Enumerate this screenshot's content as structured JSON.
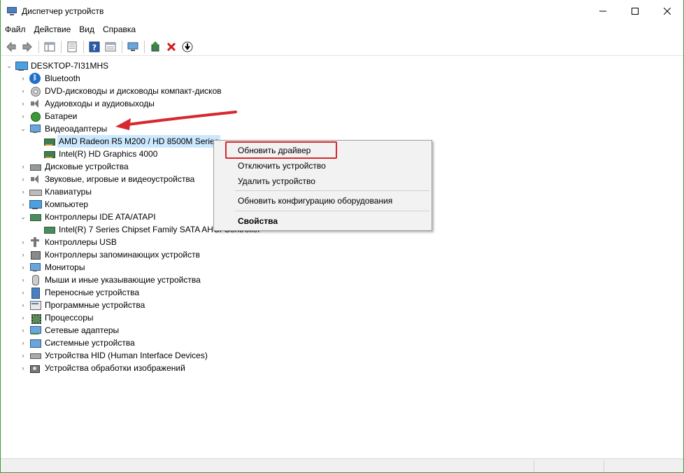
{
  "window": {
    "title": "Диспетчер устройств",
    "controls": {
      "minimize": "—",
      "maximize": "☐",
      "close": "✕"
    }
  },
  "menu": [
    "Файл",
    "Действие",
    "Вид",
    "Справка"
  ],
  "toolbar": {
    "icons": [
      "back-arrow-icon",
      "forward-arrow-icon",
      "properties-pane-icon",
      "list-view-icon",
      "help-icon",
      "details-icon",
      "scan-hardware-icon",
      "update-driver-icon",
      "uninstall-icon",
      "disable-icon"
    ]
  },
  "tree": {
    "root": "DESKTOP-7I31MHS",
    "items": [
      {
        "label": "Bluetooth",
        "icon": "bluetooth-icon",
        "expanded": false
      },
      {
        "label": "DVD-дисководы и дисководы компакт-дисков",
        "icon": "disc-drive-icon",
        "expanded": false
      },
      {
        "label": "Аудиовходы и аудиовыходы",
        "icon": "speaker-icon",
        "expanded": false
      },
      {
        "label": "Батареи",
        "icon": "battery-icon",
        "expanded": false
      },
      {
        "label": "Видеоадаптеры",
        "icon": "display-adapter-icon",
        "expanded": true
      },
      {
        "label": "AMD Radeon R5 M200 / HD 8500M Series",
        "icon": "video-card-icon",
        "child": true,
        "selected": true
      },
      {
        "label": "Intel(R) HD Graphics 4000",
        "icon": "video-card-icon",
        "child": true
      },
      {
        "label": "Дисковые устройства",
        "icon": "disk-drive-icon",
        "expanded": false
      },
      {
        "label": "Звуковые, игровые и видеоустройства",
        "icon": "speaker-icon",
        "expanded": false
      },
      {
        "label": "Клавиатуры",
        "icon": "keyboard-icon",
        "expanded": false
      },
      {
        "label": "Компьютер",
        "icon": "computer-icon",
        "expanded": false
      },
      {
        "label": "Контроллеры IDE ATA/ATAPI",
        "icon": "ide-controller-icon",
        "expanded": true
      },
      {
        "label": "Intel(R) 7 Series Chipset Family SATA AHCI Controller",
        "icon": "ide-controller-icon",
        "child": true
      },
      {
        "label": "Контроллеры USB",
        "icon": "usb-icon",
        "expanded": false
      },
      {
        "label": "Контроллеры запоминающих устройств",
        "icon": "storage-controller-icon",
        "expanded": false
      },
      {
        "label": "Мониторы",
        "icon": "monitor-icon",
        "expanded": false
      },
      {
        "label": "Мыши и иные указывающие устройства",
        "icon": "mouse-icon",
        "expanded": false
      },
      {
        "label": "Переносные устройства",
        "icon": "portable-device-icon",
        "expanded": false
      },
      {
        "label": "Программные устройства",
        "icon": "software-device-icon",
        "expanded": false
      },
      {
        "label": "Процессоры",
        "icon": "processor-icon",
        "expanded": false
      },
      {
        "label": "Сетевые адаптеры",
        "icon": "network-adapter-icon",
        "expanded": false
      },
      {
        "label": "Системные устройства",
        "icon": "system-device-icon",
        "expanded": false
      },
      {
        "label": "Устройства HID (Human Interface Devices)",
        "icon": "hid-icon",
        "expanded": false
      },
      {
        "label": "Устройства обработки изображений",
        "icon": "imaging-device-icon",
        "expanded": false
      }
    ]
  },
  "context_menu": {
    "items": [
      "Обновить драйвер",
      "Отключить устройство",
      "Удалить устройство",
      "Обновить конфигурацию оборудования",
      "Свойства"
    ],
    "highlighted": "Обновить драйвер"
  },
  "colors": {
    "selection": "#cce8ff",
    "annotation_red": "#d7282f",
    "window_border": "#3c9c3c"
  }
}
